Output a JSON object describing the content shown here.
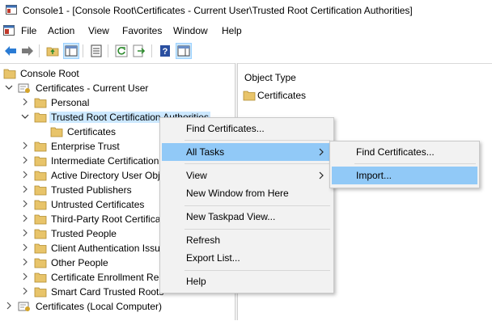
{
  "window": {
    "title": "Console1 - [Console Root\\Certificates - Current User\\Trusted Root Certification Authorities]"
  },
  "menubar": {
    "items": [
      "File",
      "Action",
      "View",
      "Favorites",
      "Window",
      "Help"
    ]
  },
  "toolbar": {
    "icons": [
      "back-arrow-icon",
      "forward-arrow-icon",
      "up-folder-icon",
      "show-hide-tree-icon",
      "properties-icon",
      "refresh-icon",
      "export-list-icon",
      "help-icon",
      "show-hide-action-pane-icon"
    ]
  },
  "tree": {
    "items": [
      {
        "label": "Console Root"
      },
      {
        "label": "Certificates - Current User"
      },
      {
        "label": "Personal"
      },
      {
        "label": "Trusted Root Certification Authorities"
      },
      {
        "label": "Certificates"
      },
      {
        "label": "Enterprise Trust"
      },
      {
        "label": "Intermediate Certification Authorities"
      },
      {
        "label": "Active Directory User Object"
      },
      {
        "label": "Trusted Publishers"
      },
      {
        "label": "Untrusted Certificates"
      },
      {
        "label": "Third-Party Root Certification Authorities"
      },
      {
        "label": "Trusted People"
      },
      {
        "label": "Client Authentication Issuers"
      },
      {
        "label": "Other People"
      },
      {
        "label": "Certificate Enrollment Requests"
      },
      {
        "label": "Smart Card Trusted Roots"
      },
      {
        "label": "Certificates (Local Computer)"
      }
    ]
  },
  "details": {
    "header": "Object Type",
    "items": [
      "Certificates"
    ]
  },
  "context_menu": {
    "items": [
      "Find Certificates...",
      "All Tasks",
      "View",
      "New Window from Here",
      "New Taskpad View...",
      "Refresh",
      "Export List...",
      "Help"
    ]
  },
  "submenu": {
    "items": [
      "Find Certificates...",
      "Import..."
    ]
  },
  "colors": {
    "highlight": "#91c9f7",
    "selection": "#cce8ff",
    "folder": "#e8c46a",
    "menu_bg": "#f2f2f2"
  }
}
